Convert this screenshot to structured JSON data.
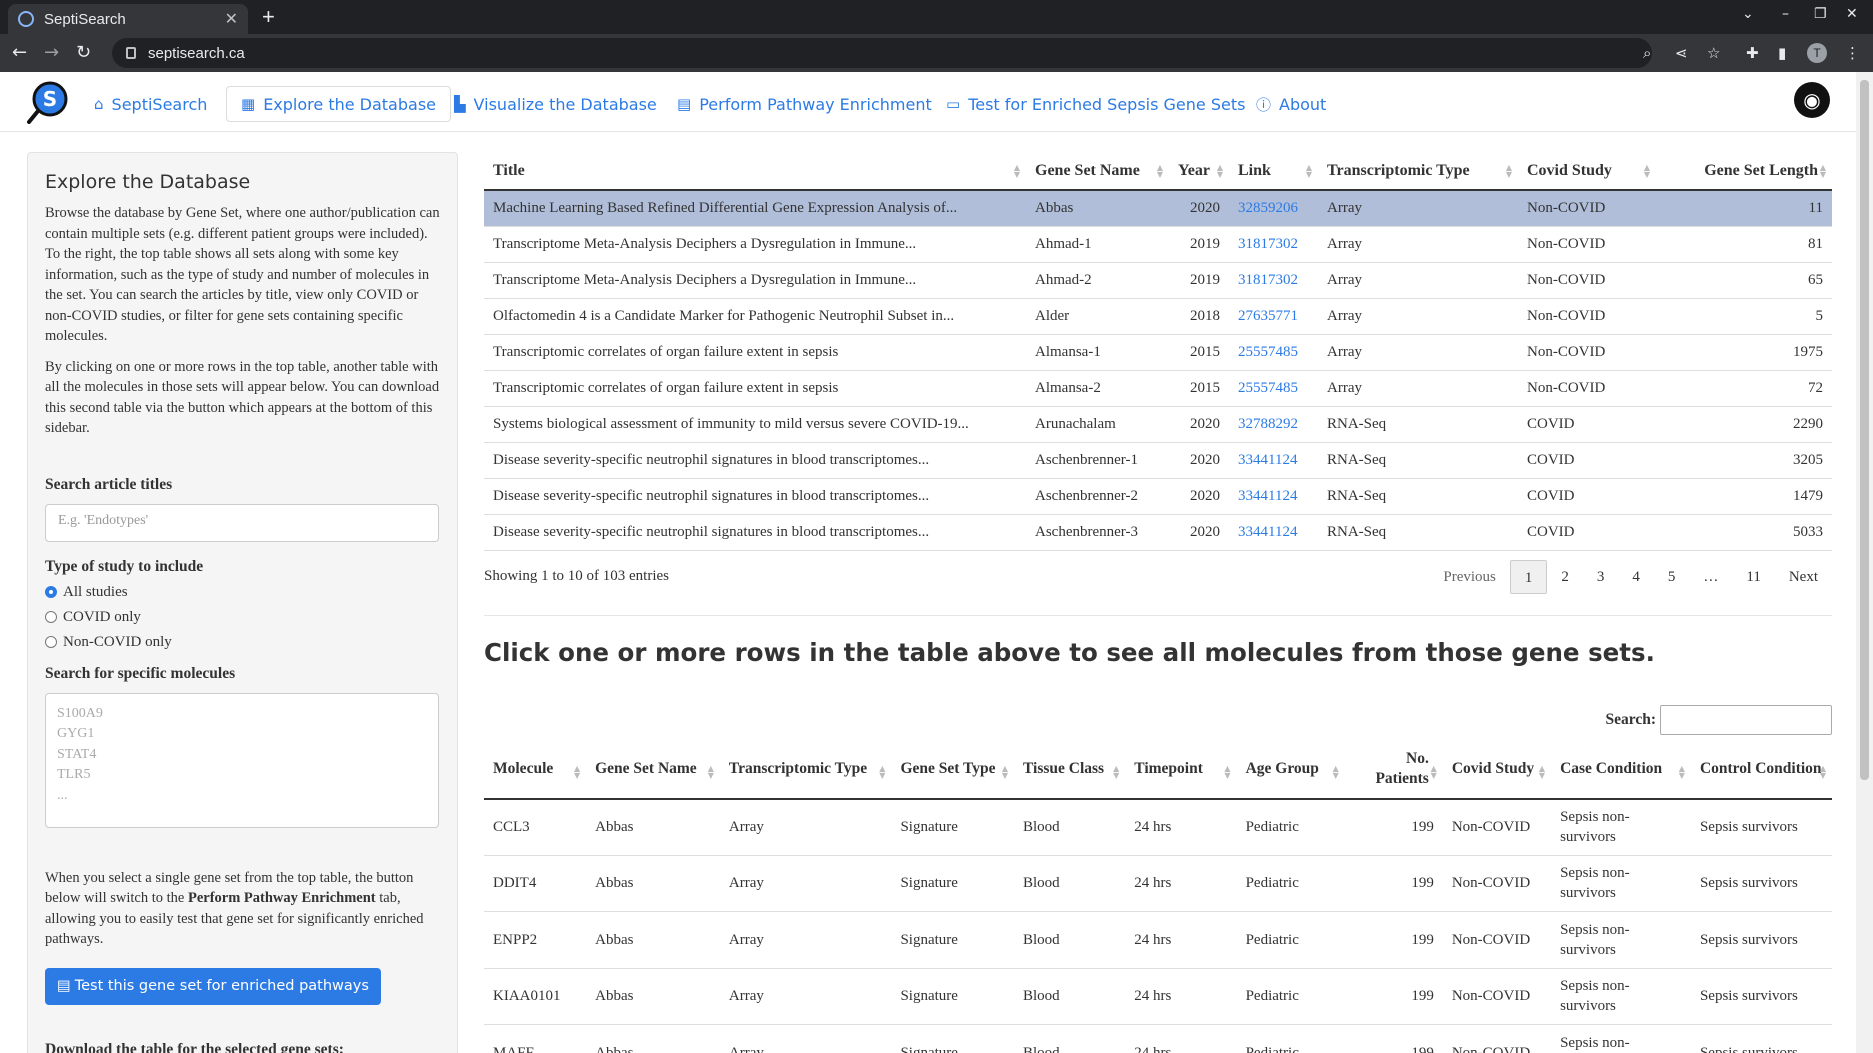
{
  "browser": {
    "tab_title": "SeptiSearch",
    "url": "septisearch.ca",
    "profile_initial": "T"
  },
  "nav": {
    "logo_letter": "S",
    "items": [
      {
        "label": "SeptiSearch",
        "icon": "home-icon"
      },
      {
        "label": "Explore the Database",
        "icon": "table-icon"
      },
      {
        "label": "Visualize the Database",
        "icon": "chart-icon"
      },
      {
        "label": "Perform Pathway Enrichment",
        "icon": "calculator-icon"
      },
      {
        "label": "Test for Enriched Sepsis Gene Sets",
        "icon": "monitor-icon"
      },
      {
        "label": "About",
        "icon": "info-icon"
      }
    ]
  },
  "sidebar": {
    "title": "Explore the Database",
    "para1": "Browse the database by Gene Set, where one author/publication can contain multiple sets (e.g. different patient groups were included). To the right, the top table shows all sets along with some key information, such as the type of study and number of molecules in the set. You can search the articles by title, view only COVID or non-COVID studies, or filter for gene sets containing specific molecules.",
    "para2": "By clicking on one or more rows in the top table, another table with all the molecules in those sets will appear below. You can download this second table via the button which appears at the bottom of this sidebar.",
    "search_label": "Search article titles",
    "search_placeholder": "E.g. 'Endotypes'",
    "study_type_label": "Type of study to include",
    "study_options": [
      "All studies",
      "COVID only",
      "Non-COVID only"
    ],
    "molecules_label": "Search for specific molecules",
    "molecules_placeholder": "S100A9\nGYG1\nSTAT4\nTLR5\n...",
    "para3_a": "When you select a single gene set from the top table, the button below will switch to the ",
    "para3_b": "Perform Pathway Enrichment",
    "para3_c": " tab, allowing you to easily test that gene set for significantly enriched pathways.",
    "test_button": "Test this gene set for enriched pathways",
    "download_label": "Download the table for the selected gene sets:"
  },
  "table1": {
    "headers": [
      "Title",
      "Gene Set Name",
      "Year",
      "Link",
      "Transcriptomic Type",
      "Covid Study",
      "Gene Set Length"
    ],
    "rows": [
      [
        "Machine Learning Based Refined Differential Gene Expression Analysis of...",
        "Abbas",
        "2020",
        "32859206",
        "Array",
        "Non-COVID",
        "11"
      ],
      [
        "Transcriptome Meta-Analysis Deciphers a Dysregulation in Immune...",
        "Ahmad-1",
        "2019",
        "31817302",
        "Array",
        "Non-COVID",
        "81"
      ],
      [
        "Transcriptome Meta-Analysis Deciphers a Dysregulation in Immune...",
        "Ahmad-2",
        "2019",
        "31817302",
        "Array",
        "Non-COVID",
        "65"
      ],
      [
        "Olfactomedin 4 is a Candidate Marker for Pathogenic Neutrophil Subset in...",
        "Alder",
        "2018",
        "27635771",
        "Array",
        "Non-COVID",
        "5"
      ],
      [
        "Transcriptomic correlates of organ failure extent in sepsis",
        "Almansa-1",
        "2015",
        "25557485",
        "Array",
        "Non-COVID",
        "1975"
      ],
      [
        "Transcriptomic correlates of organ failure extent in sepsis",
        "Almansa-2",
        "2015",
        "25557485",
        "Array",
        "Non-COVID",
        "72"
      ],
      [
        "Systems biological assessment of immunity to mild versus severe COVID-19...",
        "Arunachalam",
        "2020",
        "32788292",
        "RNA-Seq",
        "COVID",
        "2290"
      ],
      [
        "Disease severity-specific neutrophil signatures in blood transcriptomes...",
        "Aschenbrenner-1",
        "2020",
        "33441124",
        "RNA-Seq",
        "COVID",
        "3205"
      ],
      [
        "Disease severity-specific neutrophil signatures in blood transcriptomes...",
        "Aschenbrenner-2",
        "2020",
        "33441124",
        "RNA-Seq",
        "COVID",
        "1479"
      ],
      [
        "Disease severity-specific neutrophil signatures in blood transcriptomes...",
        "Aschenbrenner-3",
        "2020",
        "33441124",
        "RNA-Seq",
        "COVID",
        "5033"
      ]
    ],
    "info": "Showing 1 to 10 of 103 entries",
    "pager": [
      "Previous",
      "1",
      "2",
      "3",
      "4",
      "5",
      "…",
      "11",
      "Next"
    ]
  },
  "prompt_heading": "Click one or more rows in the table above to see all molecules from those gene sets.",
  "table2": {
    "search_label": "Search:",
    "headers": [
      "Molecule",
      "Gene Set Name",
      "Transcriptomic Type",
      "Gene Set Type",
      "Tissue Class",
      "Timepoint",
      "Age Group",
      "No. Patients",
      "Covid Study",
      "Case Condition",
      "Control Condition"
    ],
    "rows": [
      [
        "CCL3",
        "Abbas",
        "Array",
        "Signature",
        "Blood",
        "24 hrs",
        "Pediatric",
        "199",
        "Non-COVID",
        "Sepsis non-survivors",
        "Sepsis survivors"
      ],
      [
        "DDIT4",
        "Abbas",
        "Array",
        "Signature",
        "Blood",
        "24 hrs",
        "Pediatric",
        "199",
        "Non-COVID",
        "Sepsis non-survivors",
        "Sepsis survivors"
      ],
      [
        "ENPP2",
        "Abbas",
        "Array",
        "Signature",
        "Blood",
        "24 hrs",
        "Pediatric",
        "199",
        "Non-COVID",
        "Sepsis non-survivors",
        "Sepsis survivors"
      ],
      [
        "KIAA0101",
        "Abbas",
        "Array",
        "Signature",
        "Blood",
        "24 hrs",
        "Pediatric",
        "199",
        "Non-COVID",
        "Sepsis non-survivors",
        "Sepsis survivors"
      ],
      [
        "MAFF",
        "Abbas",
        "Array",
        "Signature",
        "Blood",
        "24 hrs",
        "Pediatric",
        "199",
        "Non-COVID",
        "Sepsis non-survivors",
        "Sepsis survivors"
      ]
    ]
  }
}
